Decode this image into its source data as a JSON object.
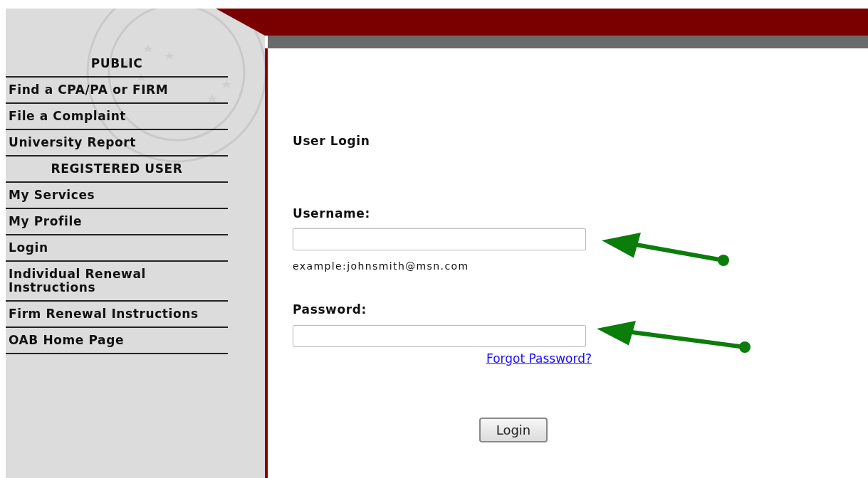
{
  "sidebar": {
    "items": [
      {
        "kind": "heading",
        "label": "PUBLIC"
      },
      {
        "kind": "link",
        "label": "Find a CPA/PA or FIRM"
      },
      {
        "kind": "link",
        "label": "File a Complaint"
      },
      {
        "kind": "link",
        "label": "University Report"
      },
      {
        "kind": "heading",
        "label": "REGISTERED USER"
      },
      {
        "kind": "link",
        "label": "My Services"
      },
      {
        "kind": "link",
        "label": "My Profile"
      },
      {
        "kind": "link",
        "label": "Login"
      },
      {
        "kind": "link",
        "label": "Individual Renewal Instructions"
      },
      {
        "kind": "link",
        "label": "Firm Renewal Instructions"
      },
      {
        "kind": "link",
        "label": "OAB Home Page"
      }
    ]
  },
  "login": {
    "title": "User Login",
    "username": {
      "label": "Username:",
      "hint": "example:johnsmith@msn.com"
    },
    "password": {
      "label": "Password:"
    },
    "forgot_link": "Forgot Password?",
    "submit": "Login"
  },
  "annotations": [
    {
      "kind": "arrow"
    },
    {
      "kind": "arrow"
    }
  ]
}
